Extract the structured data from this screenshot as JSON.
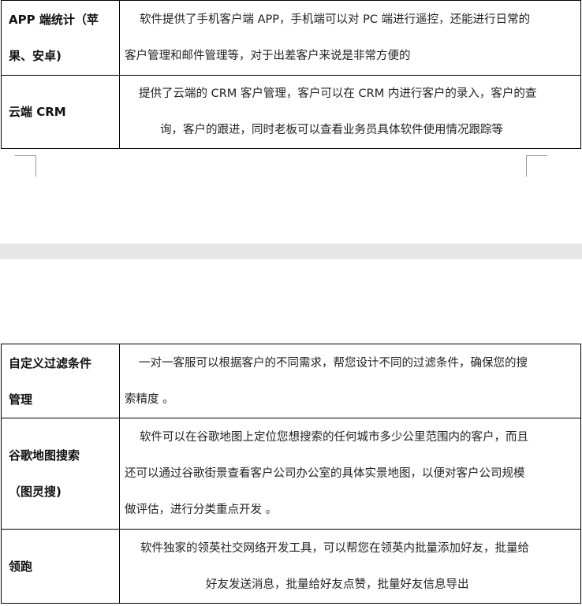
{
  "table_top": {
    "rows": [
      {
        "label_lines": [
          "APP 端统计（苹",
          "果、安卓)"
        ],
        "desc_lines": [
          "软件提供了手机客户端 APP，手机端可以对 PC 端进行遥控，还能进行日常的",
          "客户管理和邮件管理等，对于出差客户来说是非常方便的"
        ]
      },
      {
        "label_lines": [
          "云端 CRM"
        ],
        "desc_lines": [
          "提供了云端的 CRM 客户管理，客户可以在 CRM 内进行客户的录入，客户的查",
          "询，客户的跟进，同时老板可以查看业务员具体软件使用情况跟踪等"
        ]
      }
    ]
  },
  "table_bottom": {
    "rows": [
      {
        "label_lines": [
          "自定义过滤条件",
          "管理"
        ],
        "desc_lines": [
          "一对一客服可以根据客户的不同需求，帮您设计不同的过滤条件，确保您的搜",
          "索精度 。"
        ]
      },
      {
        "label_lines": [
          "谷歌地图搜索",
          "（图灵搜)"
        ],
        "desc_lines": [
          "软件可以在谷歌地图上定位您想搜索的任何城市多少公里范围内的客户，而且",
          "还可以通过谷歌街景查看客户公司办公室的具体实景地图，以便对客户公司规模",
          "做评估，进行分类重点开发 。"
        ]
      },
      {
        "label_lines": [
          "领跑"
        ],
        "desc_lines": [
          "软件独家的领英社交网络开发工具，可以帮您在领英内批量添加好友，批量给",
          "好友发送消息，批量给好友点赞，批量好友信息导出"
        ]
      }
    ]
  }
}
